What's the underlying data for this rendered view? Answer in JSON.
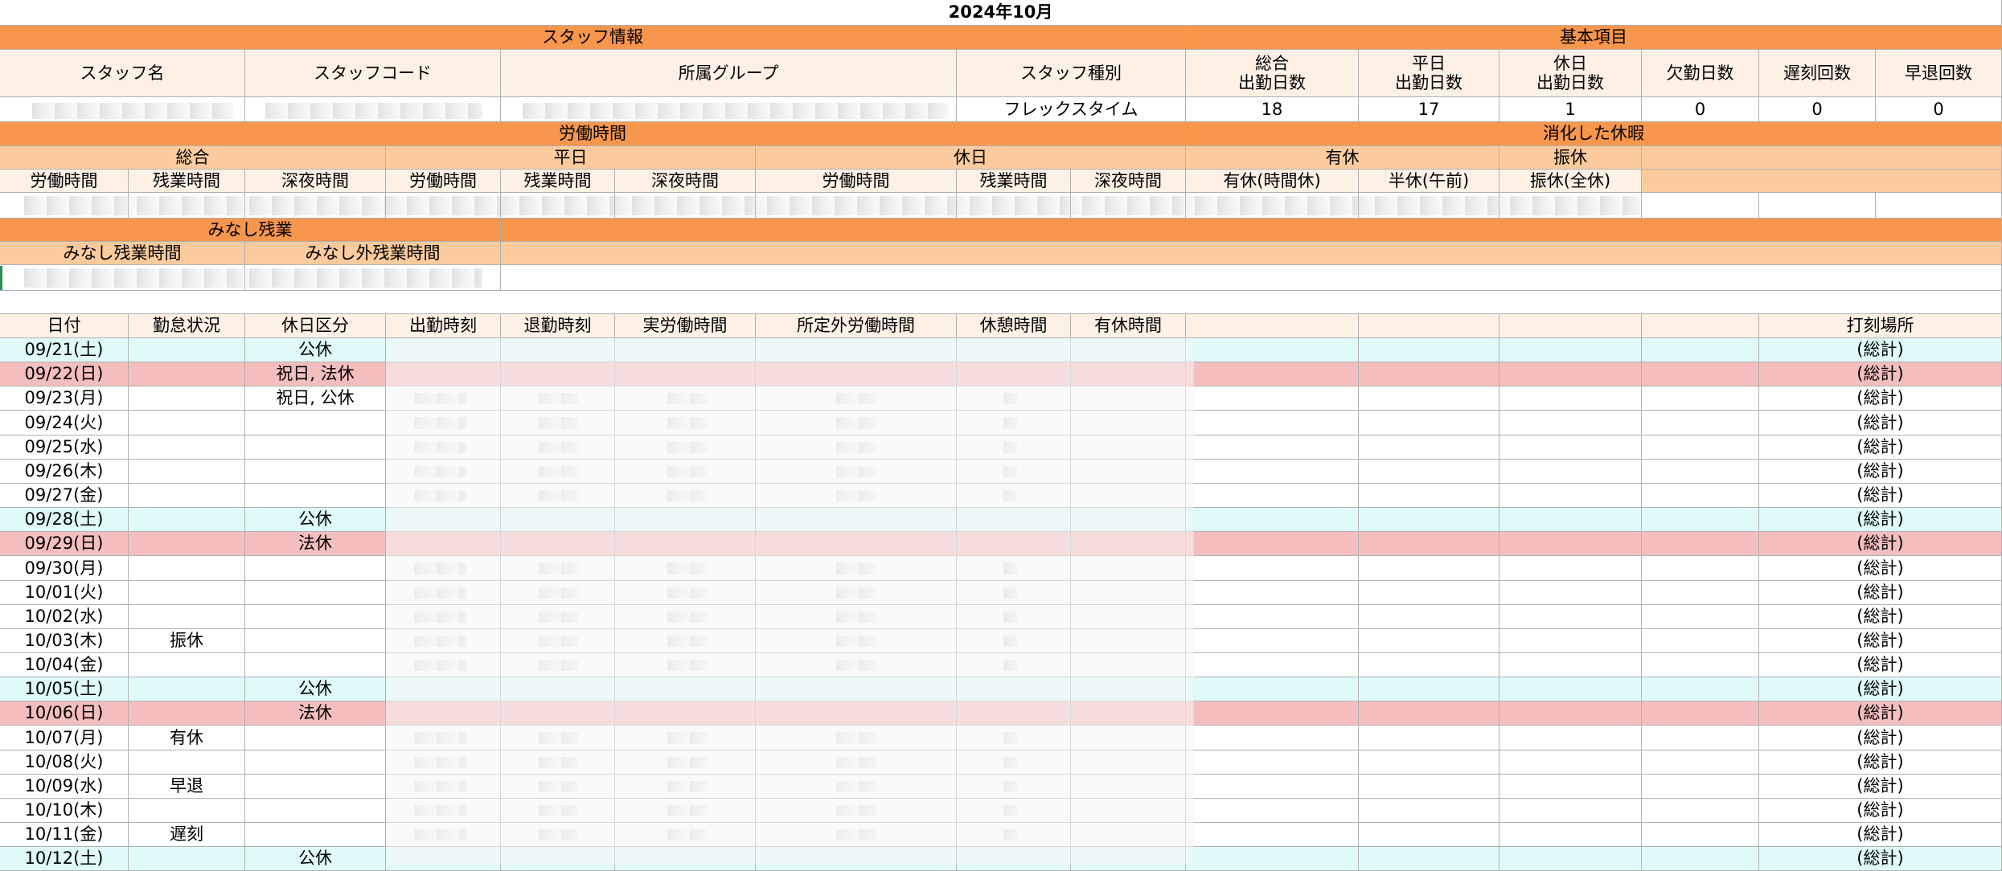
{
  "sheet": {
    "title": "2024年10月",
    "sections": {
      "staff_info": "スタッフ情報",
      "basic_items": "基本項目",
      "work_time": "労働時間",
      "used_leave": "消化した休暇",
      "deemed_overtime": "みなし残業"
    },
    "staff_headers": [
      "スタッフ名",
      "スタッフコード",
      "所属グループ",
      "スタッフ種別"
    ],
    "basic_headers": [
      "総合\n出勤日数",
      "平日\n出勤日数",
      "休日\n出勤日数",
      "欠勤日数",
      "遅刻回数",
      "早退回数"
    ],
    "staff_row": {
      "type": "フレックスタイム",
      "basic_values": [
        "18",
        "17",
        "1",
        "0",
        "0",
        "0"
      ]
    },
    "work_groups": [
      "総合",
      "平日",
      "休日"
    ],
    "leave_groups": [
      "有休",
      "振休"
    ],
    "work_headers": [
      "労働時間",
      "残業時間",
      "深夜時間",
      "労働時間",
      "残業時間",
      "深夜時間",
      "労働時間",
      "残業時間",
      "深夜時間"
    ],
    "leave_headers": [
      "有休(時間休)",
      "半休(午前)",
      "振休(全休)"
    ],
    "deemed_headers": [
      "みなし残業時間",
      "みなし外残業時間"
    ],
    "daily_headers": [
      "日付",
      "勤怠状況",
      "休日区分",
      "出勤時刻",
      "退勤時刻",
      "実労働時間",
      "所定外労働時間",
      "休憩時間",
      "有休時間",
      "打刻場所"
    ],
    "rows": [
      {
        "date": "09/21(土)",
        "status": "",
        "holiday": "公休",
        "place": "(総計)"
      },
      {
        "date": "09/22(日)",
        "status": "",
        "holiday": "祝日, 法休",
        "place": "(総計)"
      },
      {
        "date": "09/23(月)",
        "status": "",
        "holiday": "祝日, 公休",
        "place": "(総計)"
      },
      {
        "date": "09/24(火)",
        "status": "",
        "holiday": "",
        "place": "(総計)"
      },
      {
        "date": "09/25(水)",
        "status": "",
        "holiday": "",
        "place": "(総計)"
      },
      {
        "date": "09/26(木)",
        "status": "",
        "holiday": "",
        "place": "(総計)"
      },
      {
        "date": "09/27(金)",
        "status": "",
        "holiday": "",
        "place": "(総計)"
      },
      {
        "date": "09/28(土)",
        "status": "",
        "holiday": "公休",
        "place": "(総計)"
      },
      {
        "date": "09/29(日)",
        "status": "",
        "holiday": "法休",
        "place": "(総計)"
      },
      {
        "date": "09/30(月)",
        "status": "",
        "holiday": "",
        "place": "(総計)"
      },
      {
        "date": "10/01(火)",
        "status": "",
        "holiday": "",
        "place": "(総計)"
      },
      {
        "date": "10/02(水)",
        "status": "",
        "holiday": "",
        "place": "(総計)"
      },
      {
        "date": "10/03(木)",
        "status": "振休",
        "holiday": "",
        "place": "(総計)"
      },
      {
        "date": "10/04(金)",
        "status": "",
        "holiday": "",
        "place": "(総計)"
      },
      {
        "date": "10/05(土)",
        "status": "",
        "holiday": "公休",
        "place": "(総計)"
      },
      {
        "date": "10/06(日)",
        "status": "",
        "holiday": "法休",
        "place": "(総計)"
      },
      {
        "date": "10/07(月)",
        "status": "有休",
        "holiday": "",
        "place": "(総計)"
      },
      {
        "date": "10/08(火)",
        "status": "",
        "holiday": "",
        "place": "(総計)"
      },
      {
        "date": "10/09(水)",
        "status": "早退",
        "holiday": "",
        "place": "(総計)"
      },
      {
        "date": "10/10(木)",
        "status": "",
        "holiday": "",
        "place": "(総計)"
      },
      {
        "date": "10/11(金)",
        "status": "遅刻",
        "holiday": "",
        "place": "(総計)"
      },
      {
        "date": "10/12(土)",
        "status": "",
        "holiday": "公休",
        "place": "(総計)"
      }
    ],
    "colors": {
      "section_header": "#f7964d",
      "sub_header": "#fbcb9e",
      "column_header": "#fdf1e6",
      "saturday_row": "#e0fafa",
      "sunday_row": "#f5bebe"
    }
  }
}
